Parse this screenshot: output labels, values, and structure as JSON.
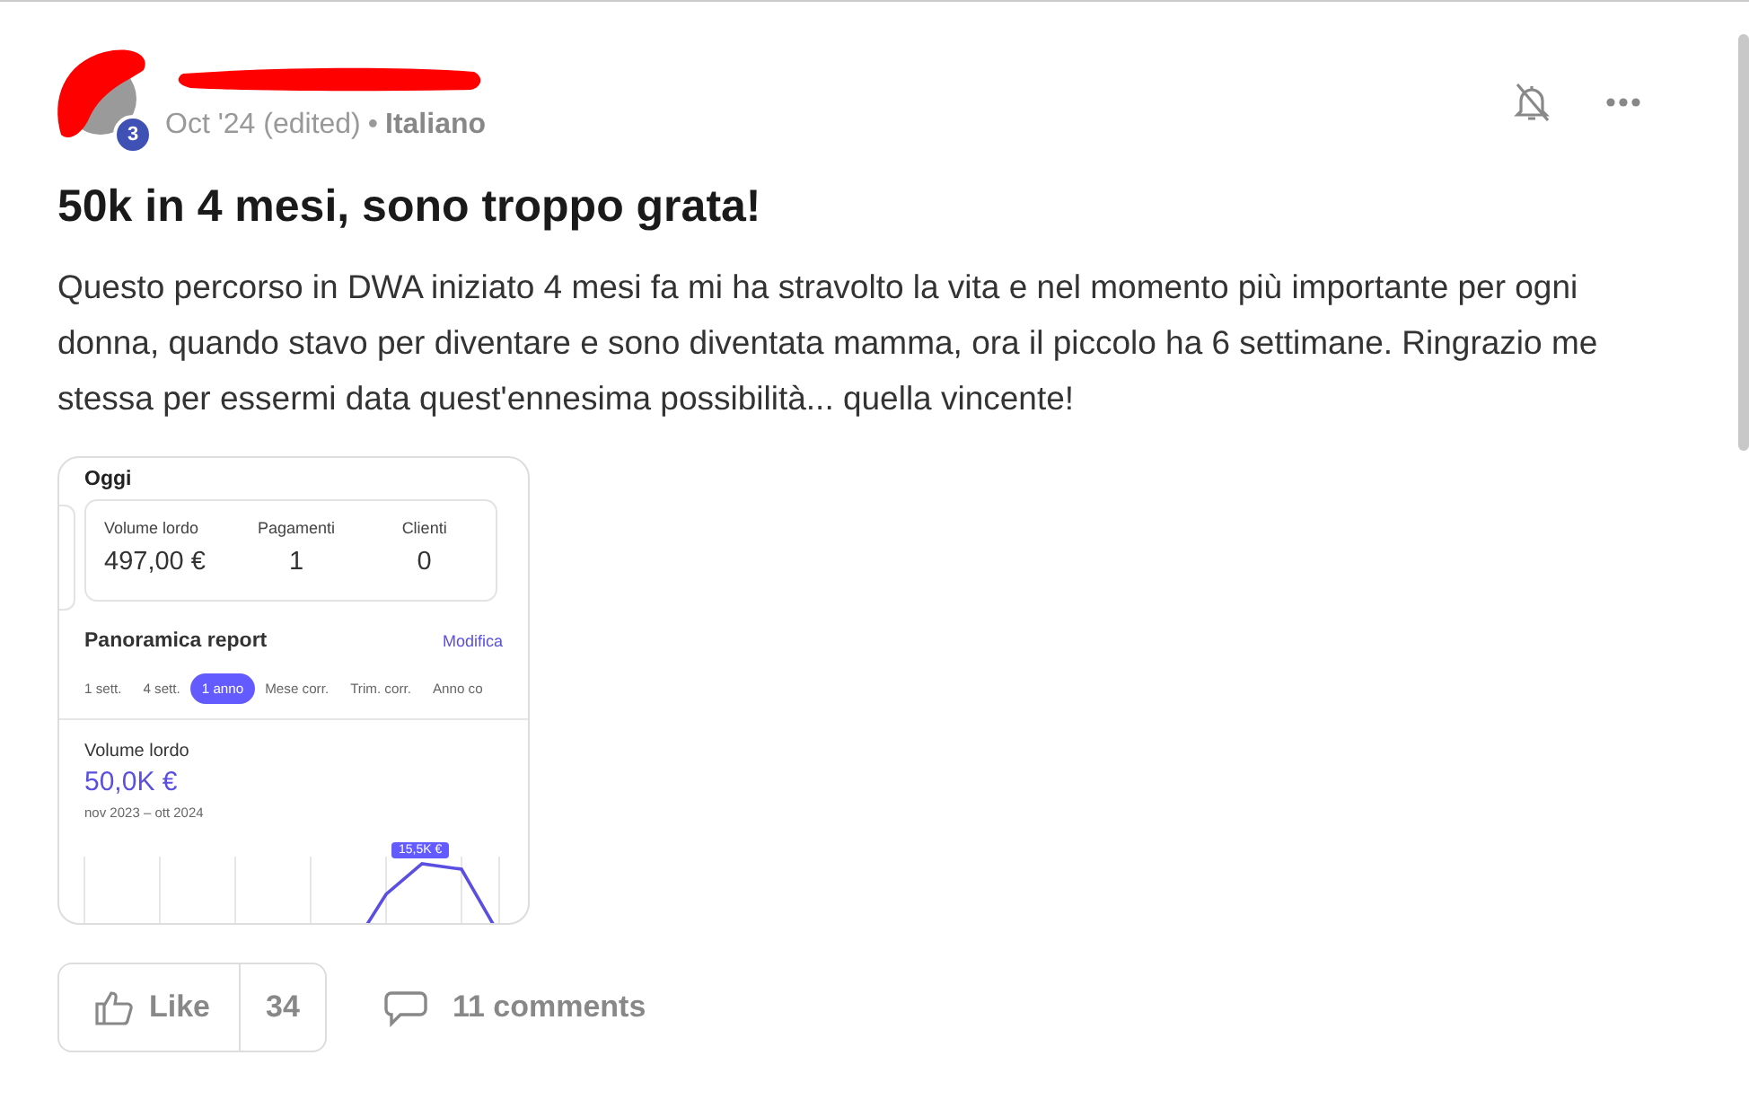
{
  "post": {
    "rank_badge": "3",
    "date": "Oct '24 (edited)",
    "separator": "•",
    "language": "Italiano",
    "muted": true,
    "title": "50k in 4 mesi, sono troppo grata!",
    "body": "Questo percorso in DWA iniziato 4 mesi fa mi ha stravolto la vita e nel momento più importante per ogni donna, quando stavo per diventare e sono diventata mamma, ora il piccolo ha 6 settimane. Ringrazio me stessa per essermi data quest'ennesima possibilità... quella vincente!"
  },
  "attachment": {
    "heading": "Oggi",
    "stats": [
      {
        "label": "Volume lordo",
        "value": "497,00 €"
      },
      {
        "label": "Pagamenti",
        "value": "1"
      },
      {
        "label": "Clienti",
        "value": "0"
      }
    ],
    "report_title": "Panoramica report",
    "edit_link": "Modifica",
    "periods": [
      {
        "label": "1 sett.",
        "selected": false
      },
      {
        "label": "4 sett.",
        "selected": false
      },
      {
        "label": "1 anno",
        "selected": true
      },
      {
        "label": "Mese corr.",
        "selected": false
      },
      {
        "label": "Trim. corr.",
        "selected": false
      },
      {
        "label": "Anno co",
        "selected": false
      }
    ],
    "metric_title": "Volume lordo",
    "metric_value": "50,0K €",
    "metric_range": "nov 2023 – ott 2024",
    "chart_tooltip": "15,5K €"
  },
  "footer": {
    "like_label": "Like",
    "like_count": "34",
    "comments": "11 comments"
  }
}
